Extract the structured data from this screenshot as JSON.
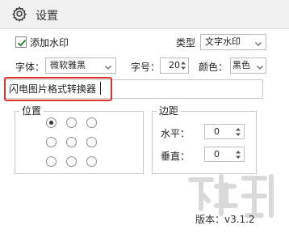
{
  "header": {
    "title": "设置",
    "icon": "gear-icon"
  },
  "watermark_option": {
    "checked": true,
    "label": "添加水印"
  },
  "type": {
    "label": "类型",
    "value": "文字水印"
  },
  "font": {
    "label": "字体：",
    "value": "微软雅黑"
  },
  "font_size": {
    "label": "字号：",
    "value": "20"
  },
  "color": {
    "label": "颜色：",
    "value": "黑色"
  },
  "watermark_text": {
    "value": "闪电图片格式转换器"
  },
  "position": {
    "title": "位置",
    "selected": {
      "row": 0,
      "col": 0
    },
    "grid": [
      [
        "top-left",
        "top-center",
        "top-right"
      ],
      [
        "middle-left",
        "center",
        "middle-right"
      ],
      [
        "bottom-left",
        "bottom-center",
        "bottom-right"
      ]
    ]
  },
  "margin": {
    "title": "边距",
    "horizontal": {
      "label": "水平：",
      "value": "0"
    },
    "vertical": {
      "label": "垂直：",
      "value": "0"
    }
  },
  "version": "版本：v3.1.2",
  "colors": {
    "highlight": "#d8322a"
  }
}
